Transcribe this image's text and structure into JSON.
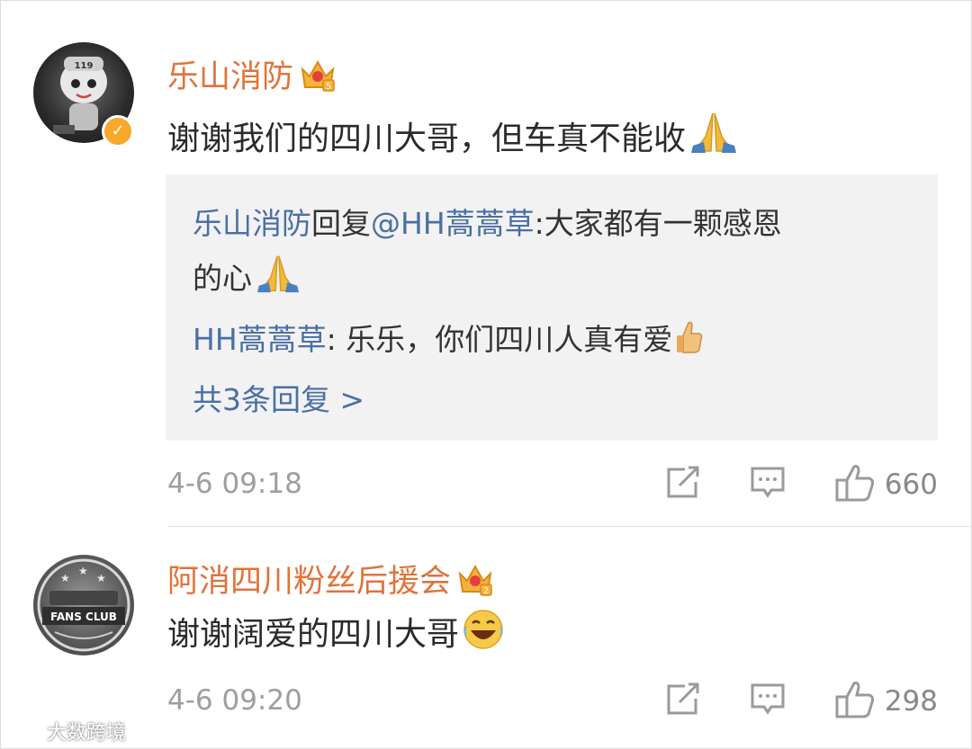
{
  "comments": [
    {
      "username": "乐山消防",
      "crown_level": "5",
      "text": "谢谢我们的四川大哥，但车真不能收",
      "replies": {
        "reply1_user": "乐山消防",
        "reply1_verb": "回复",
        "reply1_target": "@HH蒿蒿草",
        "reply1_text_line1": ":大家都有一颗感恩",
        "reply1_text_line2": "的心",
        "reply2_user": "HH蒿蒿草",
        "reply2_text": ": 乐乐，你们四川人真有爱",
        "more_link": "共3条回复 >"
      },
      "time": "4-6 09:18",
      "likes": "660"
    },
    {
      "username": "阿消四川粉丝后援会",
      "crown_level": "2",
      "avatar_text": "FANS CLUB",
      "text": "谢谢阔爱的四川大哥",
      "time": "4-6 09:20",
      "likes": "298"
    }
  ],
  "watermark": "大数跨境",
  "colors": {
    "username": "#e0733a",
    "link": "#4a6fa5",
    "meta": "#9e9e9e",
    "reply_bg": "#f2f2f2"
  },
  "icons": [
    "verified-badge-icon",
    "crown-icon",
    "pray-emoji",
    "thumbs-up-emoji",
    "laughing-emoji",
    "repost-icon",
    "comment-icon",
    "like-icon"
  ]
}
